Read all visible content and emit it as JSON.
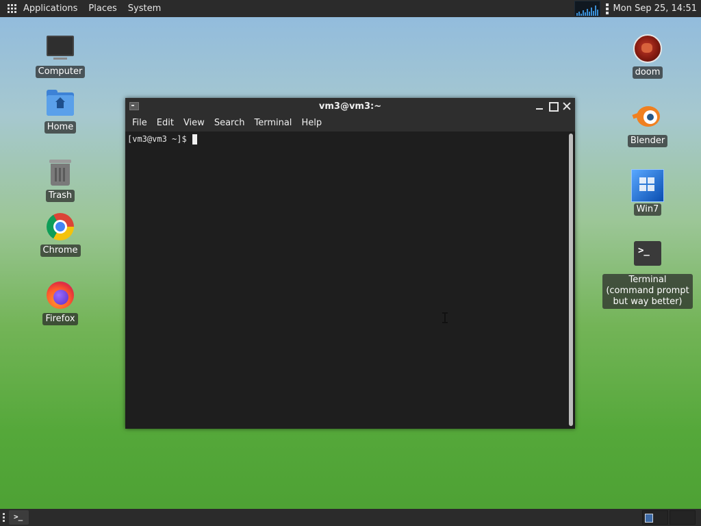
{
  "top_panel": {
    "menu": [
      "Applications",
      "Places",
      "System"
    ],
    "clock": "Mon Sep 25, 14:51",
    "icons": [
      "apps-grid-icon",
      "system-monitor-icon",
      "kebab-icon"
    ]
  },
  "desktop": {
    "left_icons": [
      {
        "label": "Computer",
        "icon": "computer-icon"
      },
      {
        "label": "Home",
        "icon": "home-folder-icon"
      },
      {
        "label": "Trash",
        "icon": "trash-icon"
      },
      {
        "label": "Chrome",
        "icon": "chrome-icon"
      },
      {
        "label": "Firefox",
        "icon": "firefox-icon"
      }
    ],
    "right_icons": [
      {
        "label": "doom",
        "icon": "doom-icon"
      },
      {
        "label": "Blender",
        "icon": "blender-icon"
      },
      {
        "label": "Win7",
        "icon": "win7-icon"
      },
      {
        "label": "Terminal (command prompt but way better)",
        "icon": "terminal-icon"
      }
    ]
  },
  "terminal_window": {
    "title": "vm3@vm3:~",
    "menu": [
      "File",
      "Edit",
      "View",
      "Search",
      "Terminal",
      "Help"
    ],
    "prompt": "[vm3@vm3 ~]$ ",
    "terminal_glyph": ">_"
  },
  "bottom_panel": {
    "task_glyph": ">_",
    "workspaces": 2,
    "active_workspace": 1
  },
  "colors": {
    "panel_bg": "#2b2b2b",
    "terminal_bg": "#1e1e1e",
    "titlebar_bg": "#2e2e2e",
    "desktop_top": "#8fbadf",
    "desktop_bottom": "#4ca033"
  }
}
